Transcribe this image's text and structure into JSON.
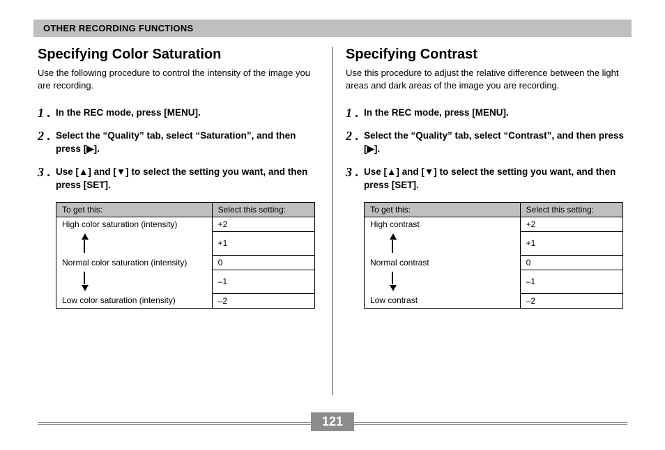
{
  "sectionTitle": "OTHER RECORDING FUNCTIONS",
  "pageNumber": "121",
  "left": {
    "heading": "Specifying Color Saturation",
    "intro": "Use the following procedure to control the intensity of the image you are recording.",
    "steps": [
      "In the REC mode, press [MENU].",
      "Select the “Quality” tab, select “Saturation”, and then press [▶].",
      "Use [▲] and [▼] to select the setting you want, and then press [SET]."
    ],
    "table": {
      "head1": "To get this:",
      "head2": "Select this setting:",
      "rowHigh": "High color saturation (intensity)",
      "rowNormal": "Normal color saturation (intensity)",
      "rowLow": "Low color saturation (intensity)",
      "valP2": "+2",
      "valP1": "+1",
      "val0": "  0",
      "valM1": "–1",
      "valM2": "–2"
    }
  },
  "right": {
    "heading": "Specifying Contrast",
    "intro": "Use this procedure to adjust the relative difference between the light areas and dark areas of the image you are recording.",
    "steps": [
      "In the REC mode, press [MENU].",
      "Select the “Quality” tab, select “Contrast”, and then press [▶].",
      "Use [▲] and [▼] to select the setting you want, and then press [SET]."
    ],
    "table": {
      "head1": "To get this:",
      "head2": "Select this setting:",
      "rowHigh": "High contrast",
      "rowNormal": "Normal contrast",
      "rowLow": "Low contrast",
      "valP2": "+2",
      "valP1": "+1",
      "val0": "  0",
      "valM1": "–1",
      "valM2": "–2"
    }
  }
}
